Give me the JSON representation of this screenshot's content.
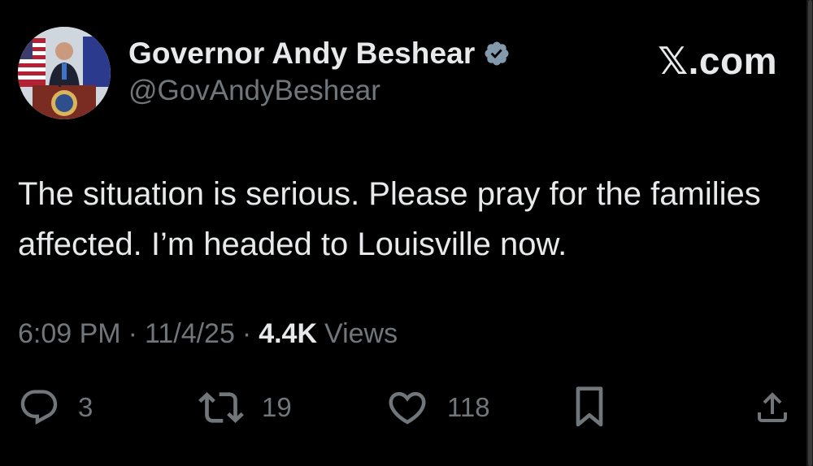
{
  "author": {
    "display_name": "Governor Andy Beshear",
    "handle": "@GovAndyBeshear",
    "verified": true,
    "verified_color": "#829aab"
  },
  "brand": "𝕏.com",
  "tweet": {
    "text": "The situation is serious. Please pray for the families affected. I’m headed to Louisville now.",
    "time": "6:09 PM",
    "date": "11/4/25",
    "separator": "·",
    "views_count": "4.4K",
    "views_label": "Views"
  },
  "actions": {
    "replies": "3",
    "reposts": "19",
    "likes": "118"
  },
  "icons": {
    "reply": "reply-icon",
    "repost": "repost-icon",
    "like": "heart-icon",
    "bookmark": "bookmark-icon",
    "share": "share-icon",
    "verified": "verified-badge-icon"
  },
  "colors": {
    "background": "#000000",
    "primary_text": "#e7e9ea",
    "secondary_text": "#71767b"
  }
}
